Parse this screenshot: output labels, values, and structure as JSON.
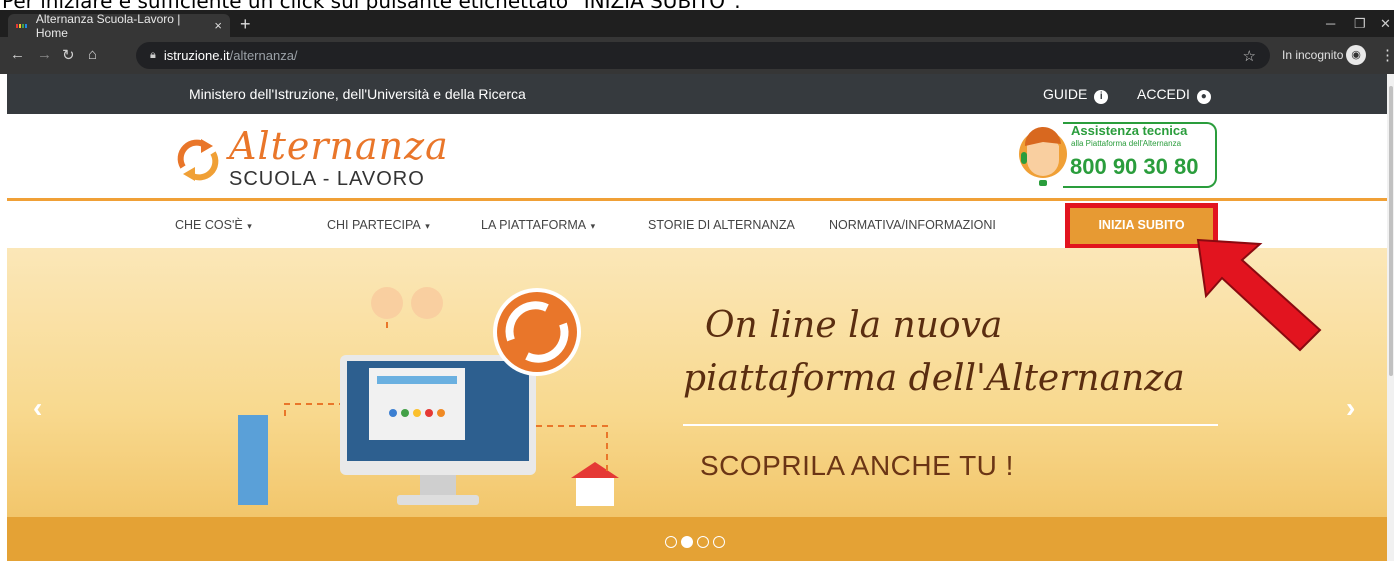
{
  "caption": "Per iniziare è sufficiente un click sul pulsante etichettato \"INIZIA SUBITO\".",
  "browser": {
    "tab_title": "Alternanza Scuola-Lavoro | Home",
    "tab_close": "×",
    "new_tab": "+",
    "url_domain": "istruzione.it",
    "url_path": "/alternanza/",
    "incognito_label": "In incognito"
  },
  "topbar": {
    "ministry": "Ministero dell'Istruzione, dell'Università e della Ricerca",
    "guide": "GUIDE",
    "accedi": "ACCEDI"
  },
  "logo": {
    "script": "Alternanza",
    "sub": "SCUOLA - LAVORO"
  },
  "assistance": {
    "title": "Assistenza tecnica",
    "subtitle": "alla Piattaforma dell'Alternanza",
    "phone": "800 90 30 80"
  },
  "nav": {
    "items": [
      "CHE COS'È",
      "CHI PARTECIPA",
      "LA PIATTAFORMA",
      "STORIE DI ALTERNANZA",
      "NORMATIVA/INFORMAZIONI"
    ],
    "cta": "INIZIA SUBITO"
  },
  "hero": {
    "title_line1": "On line la nuova",
    "title_line2": "piattaforma dell'Alternanza",
    "subtitle": "SCOPRILA ANCHE TU !",
    "active_slide": 2,
    "slide_count": 4
  },
  "colors": {
    "accent_orange": "#e79a33",
    "cta_border": "#e2141f",
    "green": "#2a9d3c",
    "title_brown": "#5a2d10"
  }
}
